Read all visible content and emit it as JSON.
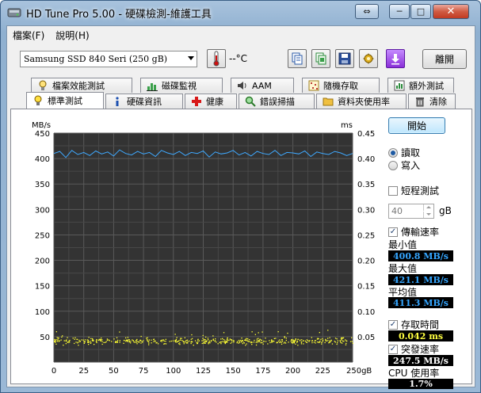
{
  "window": {
    "title": "HD Tune Pro  5.00 - 硬碟檢測-維護工具",
    "controls": {
      "minimize": "─",
      "maximize": "□",
      "close": "✕",
      "extra": "⇔"
    }
  },
  "menu": [
    {
      "label": "檔案(F)"
    },
    {
      "label": "說明(H)"
    }
  ],
  "toolbar": {
    "drive": "Samsung SSD 840 Seri     (250 gB)",
    "temperature": "--°C",
    "exit_label": "離開",
    "icons": [
      "copy-text-icon",
      "copy-screenshot-icon",
      "save-icon",
      "options-icon",
      "download-icon"
    ]
  },
  "tabs_top": [
    {
      "label": "檔案效能測試",
      "icon": "file-benchmark-icon"
    },
    {
      "label": "磁碟監視",
      "icon": "disk-monitor-icon"
    },
    {
      "label": "AAM",
      "icon": "speaker-icon"
    },
    {
      "label": "隨機存取",
      "icon": "random-access-icon"
    },
    {
      "label": "額外測試",
      "icon": "extra-tests-icon"
    }
  ],
  "tabs_bottom": [
    {
      "label": "標準測試",
      "icon": "lightbulb-icon",
      "active": true
    },
    {
      "label": "硬碟資訊",
      "icon": "info-icon"
    },
    {
      "label": "健康",
      "icon": "health-cross-icon"
    },
    {
      "label": "錯誤掃描",
      "icon": "magnifier-icon"
    },
    {
      "label": "資料夾使用率",
      "icon": "folder-icon"
    },
    {
      "label": "清除",
      "icon": "trash-icon"
    }
  ],
  "side": {
    "start_label": "開始",
    "read_label": "讀取",
    "write_label": "寫入",
    "short_test_label": "短程測試",
    "short_test_value": "40",
    "short_test_unit": "gB",
    "transfer_rate_label": "傳輸速率",
    "min_label": "最小值",
    "min_value": "400.8 MB/s",
    "max_label": "最大值",
    "max_value": "421.1 MB/s",
    "avg_label": "平均值",
    "avg_value": "411.3 MB/s",
    "access_time_label": "存取時間",
    "access_time_value": "0.042 ms",
    "burst_label": "突發速率",
    "burst_value": "247.5 MB/s",
    "cpu_label": "CPU 使用率",
    "cpu_value": "1.7%",
    "colors": {
      "blue_value": "#35a6ff",
      "yellow_value": "#ffff40"
    }
  },
  "chart_data": {
    "type": "line",
    "ylabel_left": "MB/s",
    "ylabel_right": "ms",
    "x_unit": "gB",
    "xlim": [
      0,
      250
    ],
    "ylim_left": [
      0,
      450
    ],
    "ylim_right": [
      0,
      0.45
    ],
    "x_ticks": [
      "0",
      "25",
      "50",
      "75",
      "100",
      "125",
      "150",
      "175",
      "200",
      "225",
      "250gB"
    ],
    "y_ticks_left": [
      "450",
      "400",
      "350",
      "300",
      "250",
      "200",
      "150",
      "100",
      "50"
    ],
    "y_ticks_right": [
      "0.45",
      "0.40",
      "0.35",
      "0.30",
      "0.25",
      "0.20",
      "0.15",
      "0.10",
      "0.05"
    ],
    "grid": true,
    "series": [
      {
        "kind": "line",
        "color": "#3fa9ff",
        "x": [
          0,
          5,
          10,
          15,
          20,
          25,
          30,
          35,
          40,
          45,
          50,
          55,
          60,
          65,
          70,
          75,
          80,
          85,
          90,
          95,
          100,
          105,
          110,
          115,
          120,
          125,
          130,
          135,
          140,
          145,
          150,
          155,
          160,
          165,
          170,
          175,
          180,
          185,
          190,
          195,
          200,
          205,
          210,
          215,
          220,
          225,
          230,
          235,
          240,
          245,
          250
        ],
        "y": [
          410,
          414,
          402,
          416,
          408,
          412,
          406,
          415,
          409,
          413,
          405,
          417,
          410,
          407,
          414,
          409,
          412,
          404,
          416,
          411,
          408,
          414,
          406,
          412,
          410,
          415,
          403,
          413,
          409,
          411,
          416,
          407,
          412,
          405,
          414,
          410,
          408,
          416,
          406,
          412,
          411,
          409,
          415,
          404,
          413,
          410,
          408,
          414,
          411,
          406,
          410
        ]
      },
      {
        "kind": "scatter",
        "color": "#ffff33",
        "y_axis": "right",
        "typical_ms": 0.042,
        "x": [
          0,
          250
        ],
        "y": [
          0.042,
          0.042
        ]
      }
    ]
  }
}
